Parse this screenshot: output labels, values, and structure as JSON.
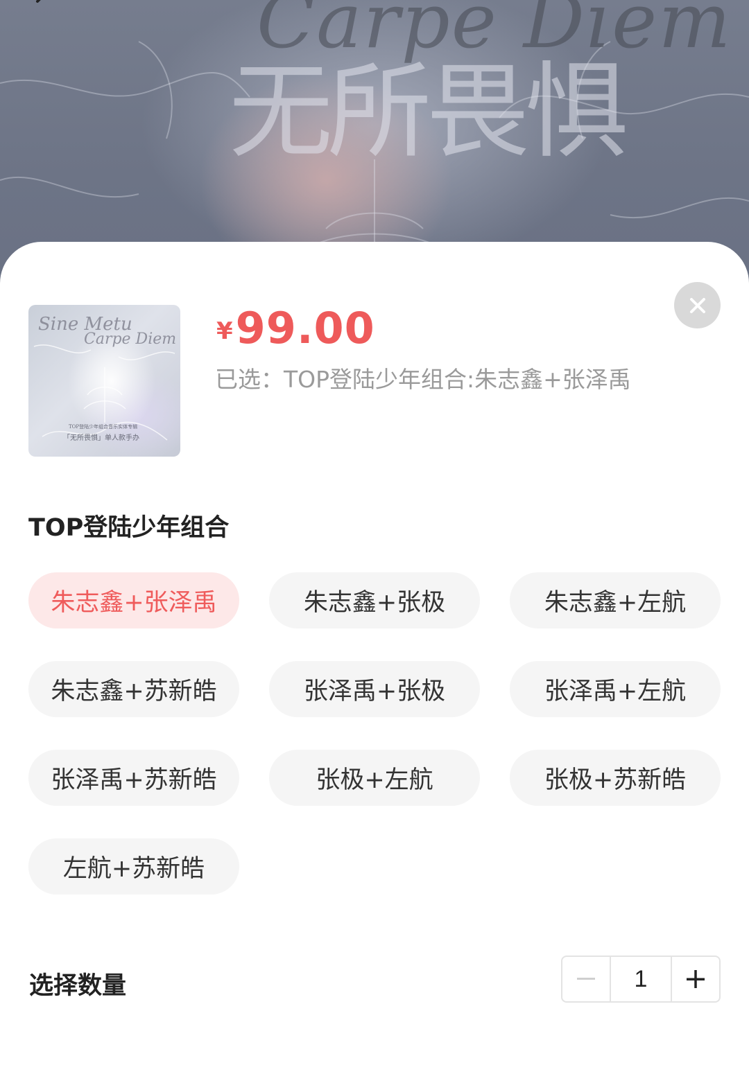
{
  "banner": {
    "script_text": "Carpe Diem",
    "calligraphy_text": "无所畏惧",
    "back_icon": "chevron-left-icon"
  },
  "product": {
    "thumb_script_1": "Sine Metu",
    "thumb_script_2": "Carpe Diem",
    "thumb_caption_1": "TOP登陆少年组合音乐实体专辑",
    "thumb_caption_2": "「无所畏惧」单人款手办",
    "currency": "¥",
    "price": "99.00",
    "price_color": "#ee5a5a",
    "selected_text": "已选：TOP登陆少年组合:朱志鑫+张泽禹"
  },
  "close_icon": "close-icon",
  "group": {
    "title": "TOP登陆少年组合",
    "options": [
      {
        "label": "朱志鑫+张泽禹",
        "selected": true
      },
      {
        "label": "朱志鑫+张极",
        "selected": false
      },
      {
        "label": "朱志鑫+左航",
        "selected": false
      },
      {
        "label": "朱志鑫+苏新皓",
        "selected": false
      },
      {
        "label": "张泽禹+张极",
        "selected": false
      },
      {
        "label": "张泽禹+左航",
        "selected": false
      },
      {
        "label": "张泽禹+苏新皓",
        "selected": false
      },
      {
        "label": "张极+左航",
        "selected": false
      },
      {
        "label": "张极+苏新皓",
        "selected": false
      },
      {
        "label": "左航+苏新皓",
        "selected": false
      }
    ]
  },
  "quantity": {
    "label": "选择数量",
    "value": "1",
    "minus_icon": "minus-icon",
    "plus_icon": "plus-icon"
  }
}
